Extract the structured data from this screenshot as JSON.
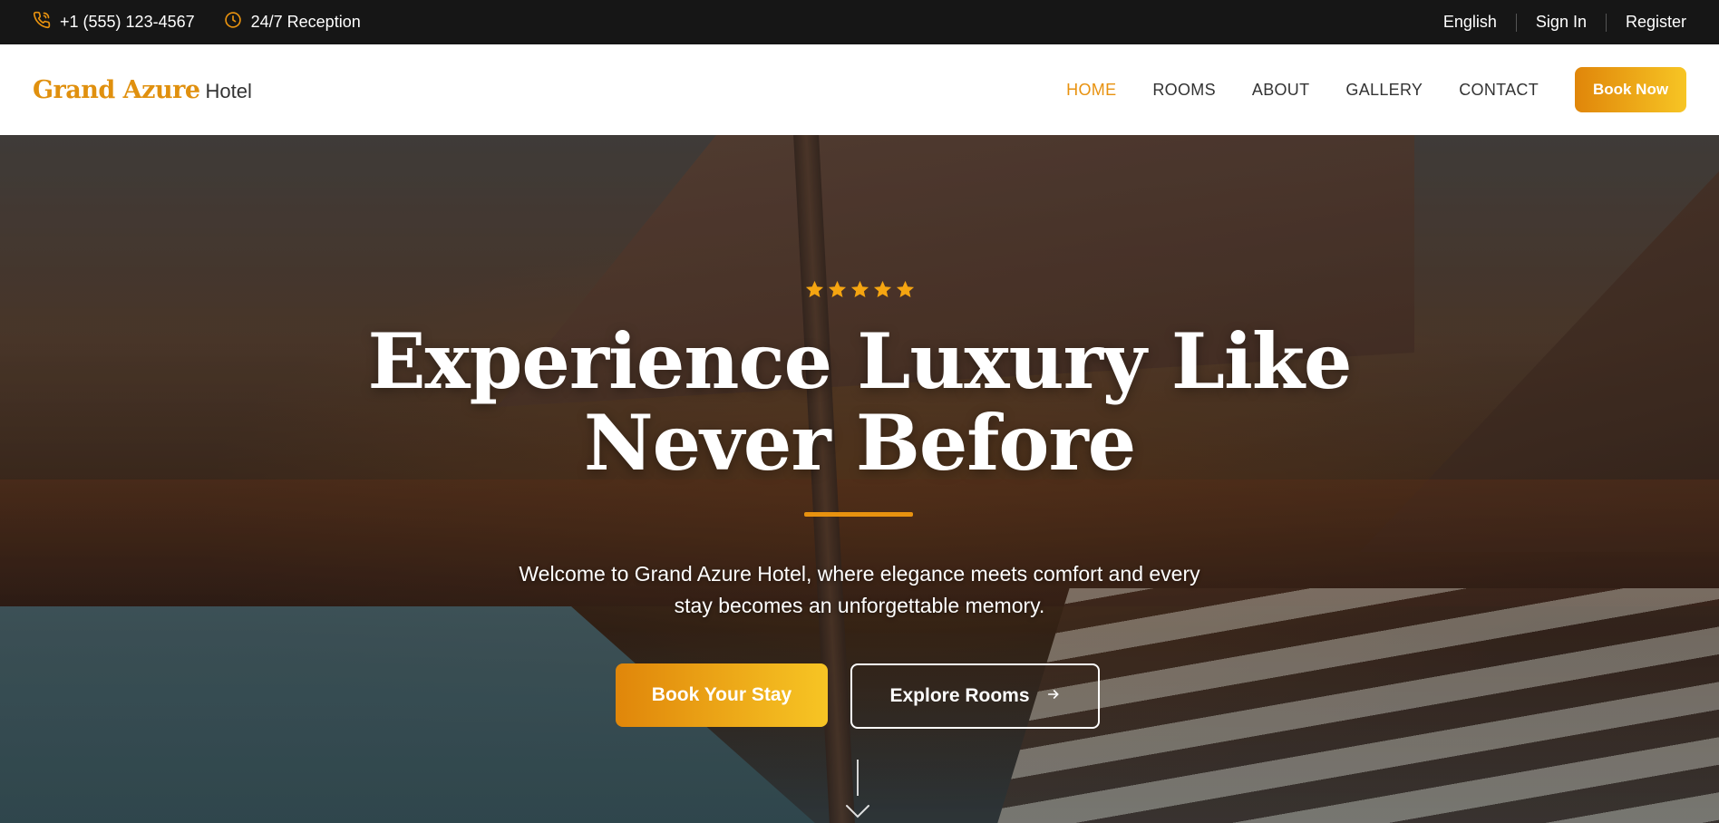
{
  "topbar": {
    "phone": "+1 (555) 123-4567",
    "reception": "24/7 Reception",
    "language": "English",
    "signin": "Sign In",
    "register": "Register"
  },
  "nav": {
    "brand": "Grand Azure",
    "brand_suffix": "Hotel",
    "items": [
      {
        "label": "HOME",
        "active": true
      },
      {
        "label": "ROOMS",
        "active": false
      },
      {
        "label": "ABOUT",
        "active": false
      },
      {
        "label": "GALLERY",
        "active": false
      },
      {
        "label": "CONTACT",
        "active": false
      }
    ],
    "book_label": "Book Now"
  },
  "hero": {
    "rating_stars": 5,
    "headline_line1": "Experience Luxury Like",
    "headline_line2": "Never Before",
    "welcome_line1": "Welcome to Grand Azure Hotel, where elegance meets comfort and every",
    "welcome_line2": "stay becomes an unforgettable memory.",
    "cta_primary": "Book Your Stay",
    "cta_secondary": "Explore Rooms"
  },
  "colors": {
    "accent": "#e8920f",
    "gradient_start": "#e0860a",
    "gradient_end": "#f7c524",
    "topbar_bg": "#161616"
  },
  "icons": [
    "phone-icon",
    "clock-icon",
    "star-icon",
    "arrow-right-icon",
    "chevron-down-icon"
  ]
}
